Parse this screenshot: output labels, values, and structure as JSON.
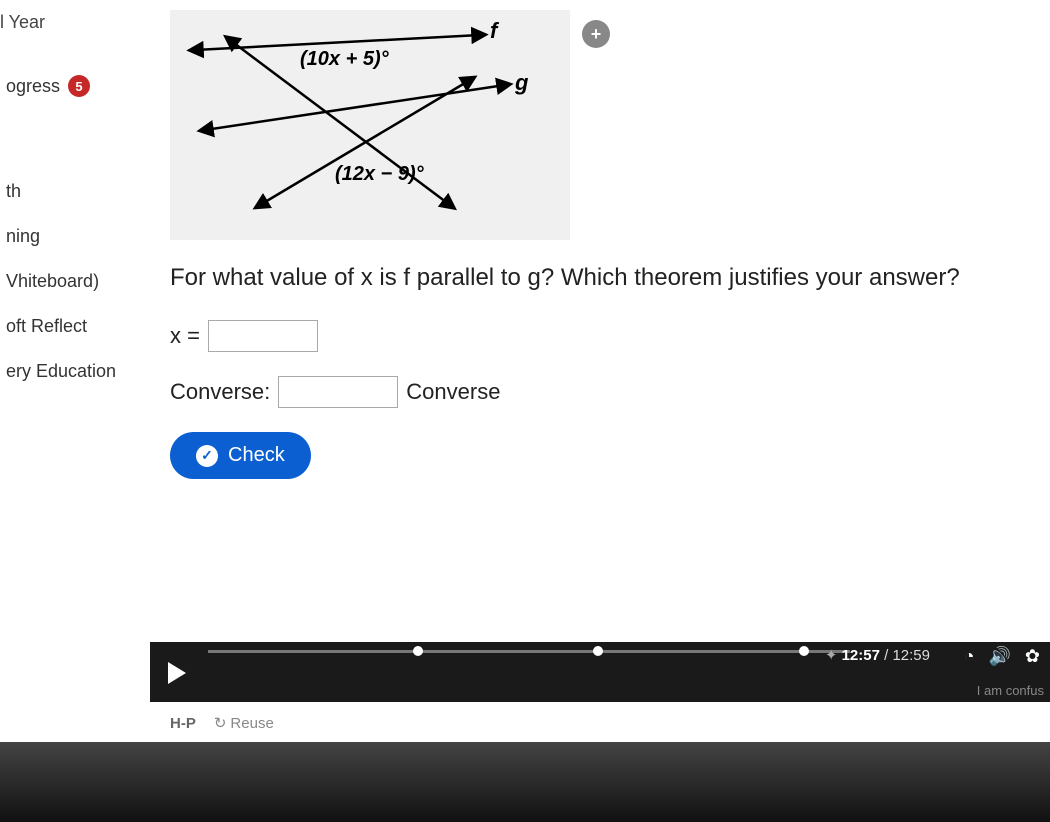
{
  "sidebar": {
    "top_label": "l Year",
    "progress_label": "ogress",
    "progress_badge": "5",
    "items": [
      {
        "label": "th"
      },
      {
        "label": "ning"
      },
      {
        "label": "Vhiteboard)"
      },
      {
        "label": "oft Reflect"
      },
      {
        "label": "ery Education"
      }
    ]
  },
  "diagram": {
    "angle_top": "(10x + 5)°",
    "angle_bottom": "(12x − 9)°",
    "line_f": "f",
    "line_g": "g"
  },
  "zoom_icon": "+",
  "question": "For what value of x is f parallel to g? Which theorem justifies your answer?",
  "answers": {
    "x_label": "x =",
    "x_value": "",
    "converse_label": "Converse:",
    "converse_value": "",
    "converse_suffix": "Converse"
  },
  "check_label": "Check",
  "video": {
    "current_time": "12:57",
    "total_time": "12:59",
    "confuse_text": "I am confus",
    "hp_label": "H-P",
    "reuse_label": "Reuse"
  },
  "chart_data": {
    "type": "diagram",
    "description": "Two lines crossed by a transversal. Line f upper, line g lower. Angle between transversal and f labeled (10x+5)°, angle between transversal and g labeled (12x−9)°, alternate interior angles configuration.",
    "labels": [
      "(10x + 5)°",
      "(12x − 9)°",
      "f",
      "g"
    ]
  }
}
